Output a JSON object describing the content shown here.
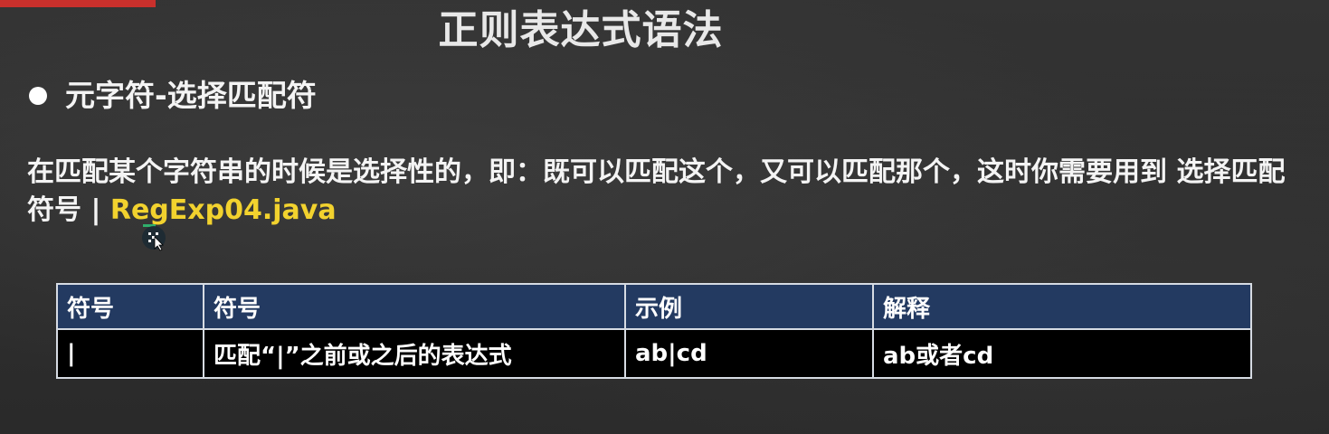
{
  "slide": {
    "title": "正则表达式语法",
    "section_heading": "元字符-选择匹配符",
    "description_main": "在匹配某个字符串的时候是选择性的，即：既可以匹配这个，又可以匹配那个，这时你需要用到 选择匹配符号 | ",
    "description_file": "RegExp04.java"
  },
  "table": {
    "headers": [
      "符号",
      "符号",
      "示例",
      "解释"
    ],
    "rows": [
      [
        "|",
        "匹配“|”之前或之后的表达式",
        "ab|cd",
        "ab或者cd"
      ]
    ]
  },
  "colors": {
    "accent_yellow": "#f2d22e",
    "header_blue": "#233a61",
    "corner_red": "#c9302c"
  },
  "icons": {
    "bullet": "bullet-dot-icon",
    "cursor": "mouse-cursor-icon"
  }
}
